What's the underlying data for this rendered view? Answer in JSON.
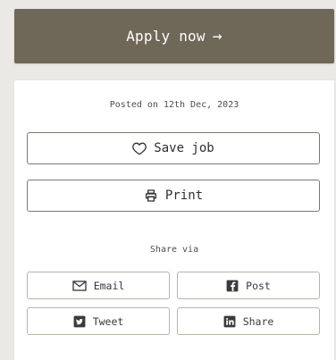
{
  "apply": {
    "label": "Apply now",
    "arrow": "→"
  },
  "card": {
    "posted_text": "Posted on 12th Dec, 2023",
    "save_job": {
      "label": "Save job",
      "icon": "heart-icon"
    },
    "print": {
      "label": "Print",
      "icon": "printer-icon"
    },
    "share_via": "Share via",
    "share_buttons": [
      {
        "label": "Email",
        "icon": "email-icon"
      },
      {
        "label": "Post",
        "icon": "facebook-icon"
      },
      {
        "label": "Tweet",
        "icon": "twitter-icon"
      },
      {
        "label": "Share",
        "icon": "linkedin-icon"
      }
    ]
  },
  "colors": {
    "page_background": "#ebe9e5",
    "apply_button": "#6f6758",
    "card_background": "#ffffff",
    "border": "#7d7870"
  }
}
